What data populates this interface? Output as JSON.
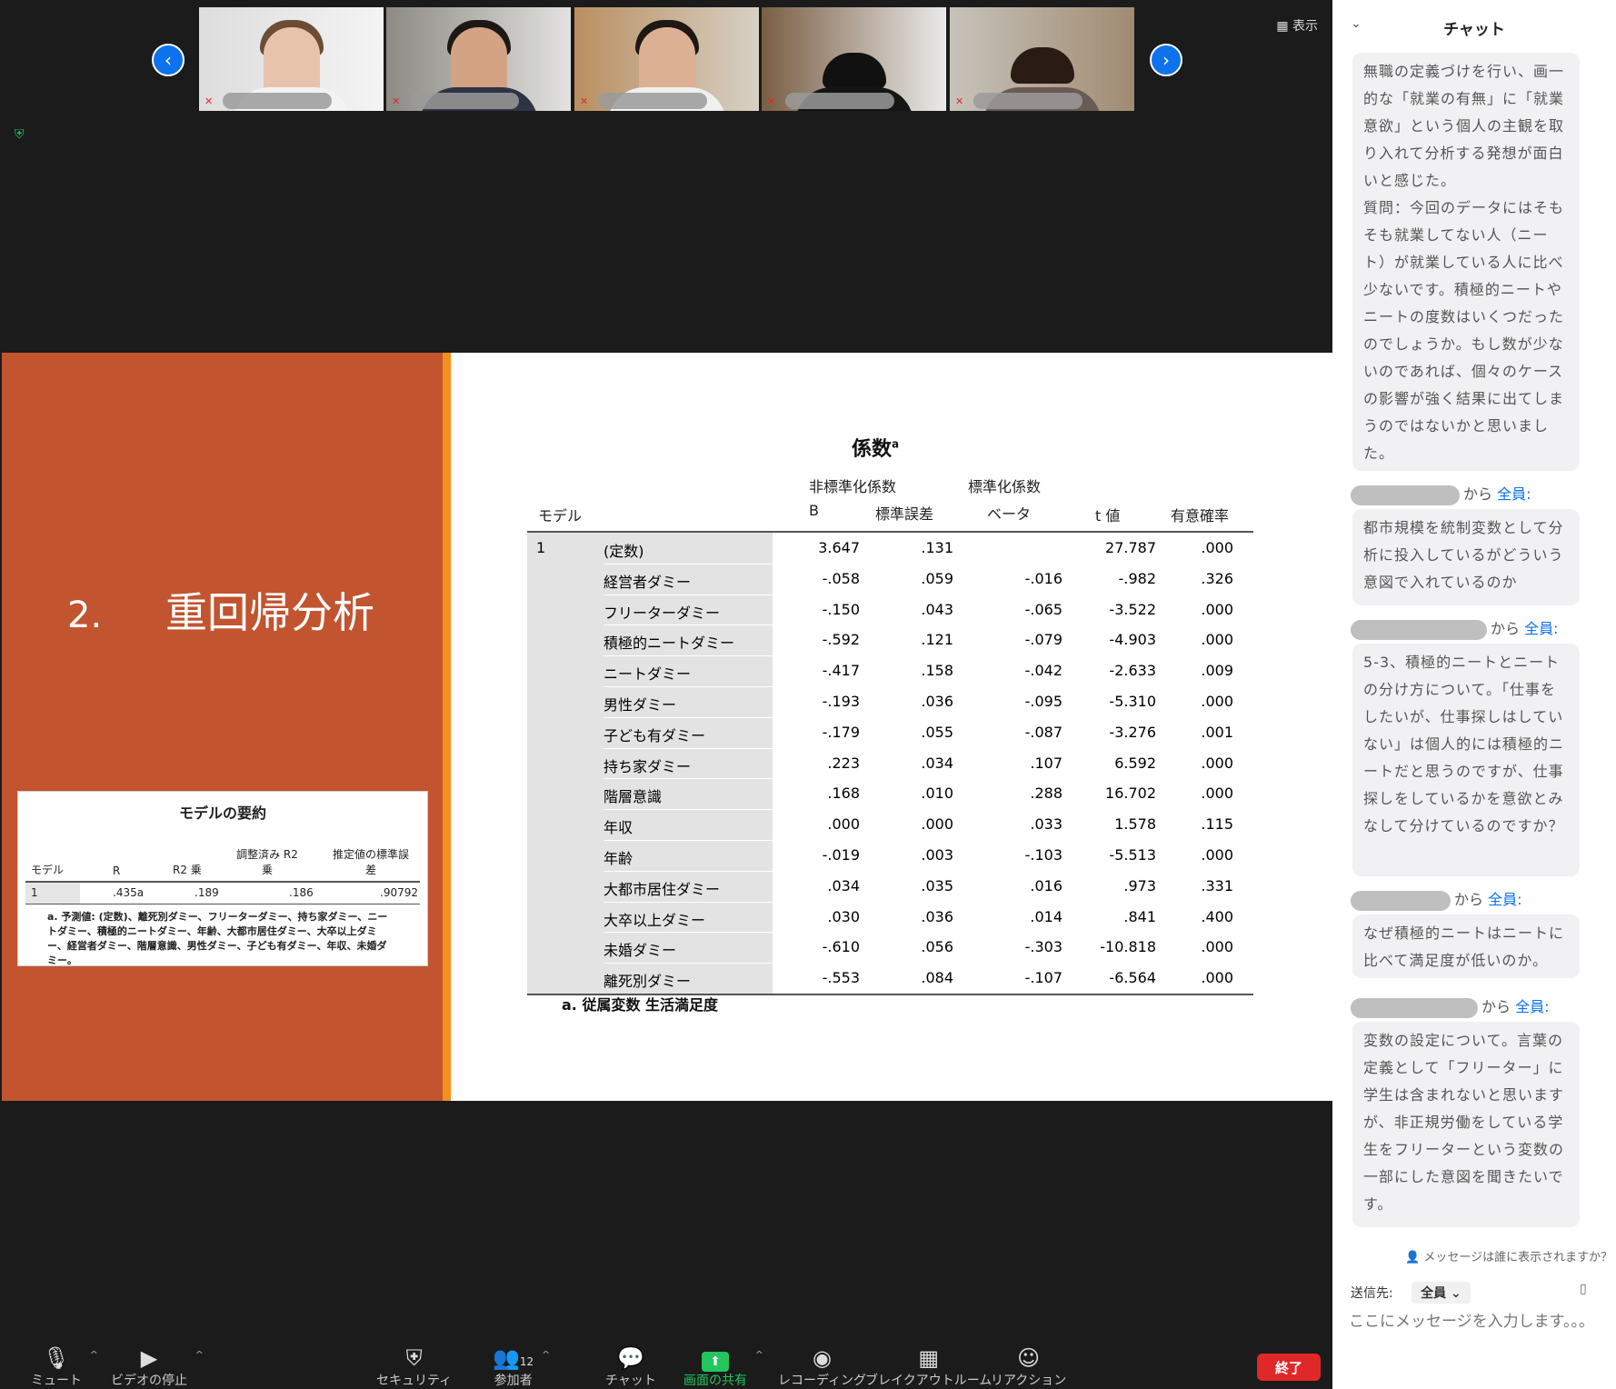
{
  "gallery": {
    "view_label": "表示"
  },
  "slide": {
    "section_number": "2.",
    "section_title": "重回帰分析",
    "summary": {
      "title": "モデルの要約",
      "headers": [
        "モデル",
        "R",
        "R2 乗",
        "調整済み R2 乗",
        "推定値の標準誤差"
      ],
      "row": [
        "1",
        ".435a",
        ".189",
        ".186",
        ".90792"
      ],
      "footnote": "a. 予測値: (定数)、離死別ダミー、フリーターダミー、持ち家ダミー、ニートダミー、積極的ニートダミー、年齢、大都市居住ダミー、大卒以上ダミー、経営者ダミー、階層意識、男性ダミー、子ども有ダミー、年収、未婚ダミー。"
    },
    "coef": {
      "title": "係数",
      "title_sup": "a",
      "group_unstd": "非標準化係数",
      "group_std": "標準化係数",
      "col_model": "モデル",
      "col_b": "B",
      "col_se": "標準誤差",
      "col_beta": "ベータ",
      "col_t": "t 値",
      "col_p": "有意確率",
      "model_no": "1",
      "rows": [
        {
          "name": "(定数)",
          "b": "3.647",
          "se": ".131",
          "beta": "",
          "t": "27.787",
          "p": ".000"
        },
        {
          "name": "経営者ダミー",
          "b": "-.058",
          "se": ".059",
          "beta": "-.016",
          "t": "-.982",
          "p": ".326"
        },
        {
          "name": "フリーターダミー",
          "b": "-.150",
          "se": ".043",
          "beta": "-.065",
          "t": "-3.522",
          "p": ".000"
        },
        {
          "name": "積極的ニートダミー",
          "b": "-.592",
          "se": ".121",
          "beta": "-.079",
          "t": "-4.903",
          "p": ".000"
        },
        {
          "name": "ニートダミー",
          "b": "-.417",
          "se": ".158",
          "beta": "-.042",
          "t": "-2.633",
          "p": ".009"
        },
        {
          "name": "男性ダミー",
          "b": "-.193",
          "se": ".036",
          "beta": "-.095",
          "t": "-5.310",
          "p": ".000"
        },
        {
          "name": "子ども有ダミー",
          "b": "-.179",
          "se": ".055",
          "beta": "-.087",
          "t": "-3.276",
          "p": ".001"
        },
        {
          "name": "持ち家ダミー",
          "b": ".223",
          "se": ".034",
          "beta": ".107",
          "t": "6.592",
          "p": ".000"
        },
        {
          "name": "階層意識",
          "b": ".168",
          "se": ".010",
          "beta": ".288",
          "t": "16.702",
          "p": ".000"
        },
        {
          "name": "年収",
          "b": ".000",
          "se": ".000",
          "beta": ".033",
          "t": "1.578",
          "p": ".115"
        },
        {
          "name": "年齢",
          "b": "-.019",
          "se": ".003",
          "beta": "-.103",
          "t": "-5.513",
          "p": ".000"
        },
        {
          "name": "大都市居住ダミー",
          "b": ".034",
          "se": ".035",
          "beta": ".016",
          "t": ".973",
          "p": ".331"
        },
        {
          "name": "大卒以上ダミー",
          "b": ".030",
          "se": ".036",
          "beta": ".014",
          "t": ".841",
          "p": ".400"
        },
        {
          "name": "未婚ダミー",
          "b": "-.610",
          "se": ".056",
          "beta": "-.303",
          "t": "-10.818",
          "p": ".000"
        },
        {
          "name": "離死別ダミー",
          "b": "-.553",
          "se": ".084",
          "beta": "-.107",
          "t": "-6.564",
          "p": ".000"
        }
      ],
      "footnote": "a. 従属変数 生活満足度"
    }
  },
  "chat": {
    "title": "チャット",
    "messages": [
      {
        "text": "無職の定義づけを行い、画一的な「就業の有無」に「就業意欲」という個人の主観を取り入れて分析する発想が面白いと感じた。\n質問：今回のデータにはそもそも就業してない人（ニート）が就業している人に比べ少ないです。積極的ニートやニートの度数はいくつだったのでしょうか。もし数が少ないのであれば、個々のケースの影響が強く結果に出てしまうのではないかと思いました。"
      },
      {
        "from": "から",
        "to": "全員:",
        "text": "都市規模を統制変数として分析に投入しているがどういう意図で入れているのか"
      },
      {
        "from": "から",
        "to": "全員:",
        "text": "5-3、積極的ニートとニートの分け方について。「仕事をしたいが、仕事探しはしていない」は個人的には積極的ニートだと思うのですが、仕事探しをしているかを意欲とみなして分けているのですか？"
      },
      {
        "from": "から",
        "to": "全員:",
        "text": "なぜ積極的ニートはニートに比べて満足度が低いのか。"
      },
      {
        "from": "から",
        "to": "全員:",
        "text": "変数の設定について。言葉の定義として「フリーター」に学生は含まれないと思いますが、非正規労働をしている学生をフリーターという変数の一部にした意図を聞きたいです。"
      }
    ],
    "who_can_see": "メッセージは誰に表示されますか？",
    "to_label": "送信先:",
    "to_value": "全員",
    "input_placeholder": "ここにメッセージを入力します。。。"
  },
  "toolbar": {
    "mute": "ミュート",
    "video": "ビデオの停止",
    "security": "セキュリティ",
    "participants": "参加者",
    "participants_count": "12",
    "chat": "チャット",
    "share": "画面の共有",
    "record": "レコーディング",
    "breakout": "ブレイクアウトルーム",
    "reaction": "リアクション",
    "end": "終了"
  }
}
